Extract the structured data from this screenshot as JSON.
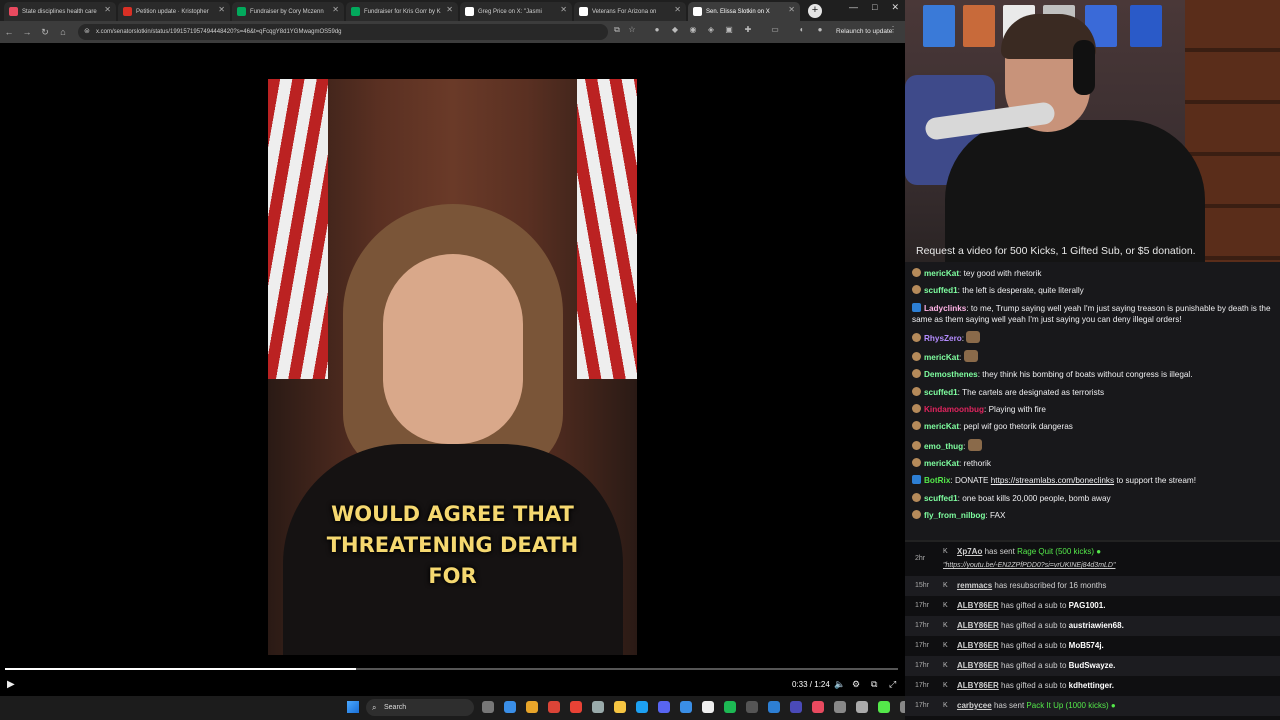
{
  "browser": {
    "tabs": [
      {
        "title": "State disciplines health care",
        "color": "#e84a5f"
      },
      {
        "title": "Petition update · Kristopher",
        "color": "#d93025"
      },
      {
        "title": "Fundraiser by Cory Mczenn",
        "color": "#02a95c"
      },
      {
        "title": "Fundraiser for Kris Gorr by K",
        "color": "#02a95c"
      },
      {
        "title": "Greg Price on X: \"Jasmi",
        "color": "#ffffff"
      },
      {
        "title": "Veterans For Arizona on",
        "color": "#ffffff"
      },
      {
        "title": "Sen. Elissa Slotkin on X",
        "color": "#ffffff"
      }
    ],
    "url": "x.com/senatorslotkin/status/1991571957494448420?s=46&t=qFcqgY8d1YGMwagmOS59dg",
    "relaunch_label": "Relaunch to update"
  },
  "video": {
    "caption_lines": [
      "WOULD AGREE THAT",
      "THREATENING DEATH",
      "FOR"
    ],
    "time": "0:33 / 1:24",
    "progress": 0.393
  },
  "taskbar": {
    "search_label": "Search"
  },
  "webcam": {
    "banner": "Request a video for 500 Kicks, 1 Gifted Sub, or $5 donation."
  },
  "chat": {
    "messages": [
      {
        "user": "mericKat",
        "user_color": "#7fffa0",
        "text": "tey good with rhetorik"
      },
      {
        "user": "scuffed1",
        "user_color": "#7fffa0",
        "text": "the left is desperate, quite literally"
      },
      {
        "user": "Ladyclinks",
        "user_color": "#ffb3e6",
        "text": "to me, Trump saying well yeah I'm just saying treason is punishable by death is the same as them saying well yeah I'm just saying you can deny illegal orders!"
      },
      {
        "user": "RhysZero",
        "user_color": "#b48cff",
        "text": ""
      },
      {
        "user": "mericKat",
        "user_color": "#7fffa0",
        "text": ""
      },
      {
        "user": "Demosthenes",
        "user_color": "#7fffa0",
        "text": "they think his bombing of boats without congress is illegal."
      },
      {
        "user": "scuffed1",
        "user_color": "#7fffa0",
        "text": "The cartels are designated as terrorists"
      },
      {
        "user": "Kindamoonbug",
        "user_color": "#e0245e",
        "text": "Playing with fire"
      },
      {
        "user": "mericKat",
        "user_color": "#7fffa0",
        "text": "pepl wif goo thetorik dangeras"
      },
      {
        "user": "emo_thug",
        "user_color": "#7fffa0",
        "text": ""
      },
      {
        "user": "mericKat",
        "user_color": "#7fffa0",
        "text": "rethorik"
      },
      {
        "user": "BotRix",
        "user_color": "#54e84a",
        "text_before": "DONATE ",
        "link": "https://streamlabs.com/boneclinks",
        "text_after": " to support the stream!"
      },
      {
        "user": "scuffed1",
        "user_color": "#7fffa0",
        "text": "one boat kills 20,000 people, bomb away"
      },
      {
        "user": "fly_from_nilbog",
        "user_color": "#7fffa0",
        "text": "FAX"
      }
    ]
  },
  "feed": {
    "events": [
      {
        "time": "2hr",
        "user": "Xp7Ao",
        "action": "has sent",
        "item": "Rage Quit (500 kicks)",
        "note": "\"https://youtu.be/-EN2ZPfPDD0?si=vrUKINEj84d3mLD\""
      },
      {
        "time": "15hr",
        "user": "remmacs",
        "action": "has resubscribed for 16 months"
      },
      {
        "time": "17hr",
        "user": "ALBY86ER",
        "action": "has gifted a sub to",
        "target": "PAG1001."
      },
      {
        "time": "17hr",
        "user": "ALBY86ER",
        "action": "has gifted a sub to",
        "target": "austriawien68."
      },
      {
        "time": "17hr",
        "user": "ALBY86ER",
        "action": "has gifted a sub to",
        "target": "MoB574j."
      },
      {
        "time": "17hr",
        "user": "ALBY86ER",
        "action": "has gifted a sub to",
        "target": "BudSwayze."
      },
      {
        "time": "17hr",
        "user": "ALBY86ER",
        "action": "has gifted a sub to",
        "target": "kdhettinger."
      },
      {
        "time": "17hr",
        "user": "carbycee",
        "action": "has sent",
        "item": "Pack It Up (1000 kicks)"
      }
    ]
  }
}
